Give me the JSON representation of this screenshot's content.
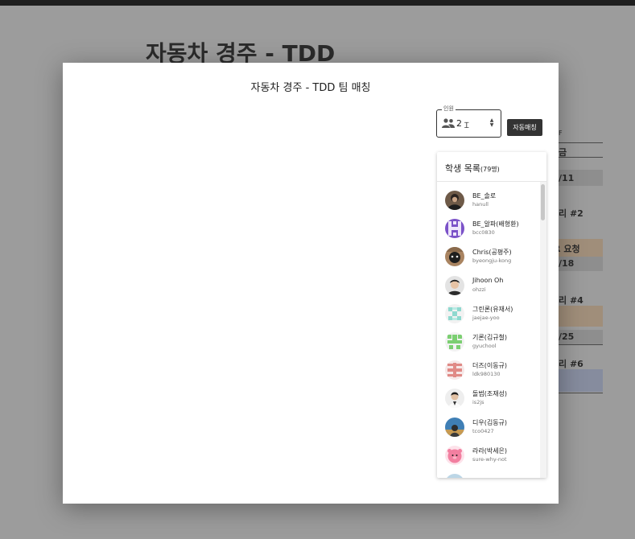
{
  "background": {
    "title": "자동차 경주 - TDD",
    "sheet_rows": [
      "F",
      "금",
      "/11",
      "리 #2",
      "PR 요청",
      "/18",
      "리 #4",
      "/25",
      "리 #6"
    ]
  },
  "modal": {
    "title": "자동차 경주 - TDD 팀 매칭",
    "count_field": {
      "legend": "인원",
      "value": "2"
    },
    "auto_match_label": "자동매칭",
    "panel": {
      "title": "학생 목록",
      "count": "(79명)",
      "students": [
        {
          "name": "BE_솔로",
          "login": "hanull",
          "avatar": "photo-dark"
        },
        {
          "name": "BE_알파(배형환)",
          "login": "bcc0830",
          "avatar": "identicon-purple"
        },
        {
          "name": "Chris(공평주)",
          "login": "byeongju-kong",
          "avatar": "photo-warm"
        },
        {
          "name": "Jihoon Oh",
          "login": "ohzzi",
          "avatar": "photo-person"
        },
        {
          "name": "그린론(유재서)",
          "login": "jaejae-yoo",
          "avatar": "identicon-teal"
        },
        {
          "name": "기론(김규철)",
          "login": "gyuchool",
          "avatar": "identicon-green"
        },
        {
          "name": "더즈(이동규)",
          "login": "ldk980130",
          "avatar": "identicon-red"
        },
        {
          "name": "돌범(조재성)",
          "login": "is2js",
          "avatar": "photo-person-light"
        },
        {
          "name": "디우(김동규)",
          "login": "tco0427",
          "avatar": "photo-blue"
        },
        {
          "name": "라라(박세은)",
          "login": "sure-why-not",
          "avatar": "pink-character"
        }
      ]
    }
  }
}
